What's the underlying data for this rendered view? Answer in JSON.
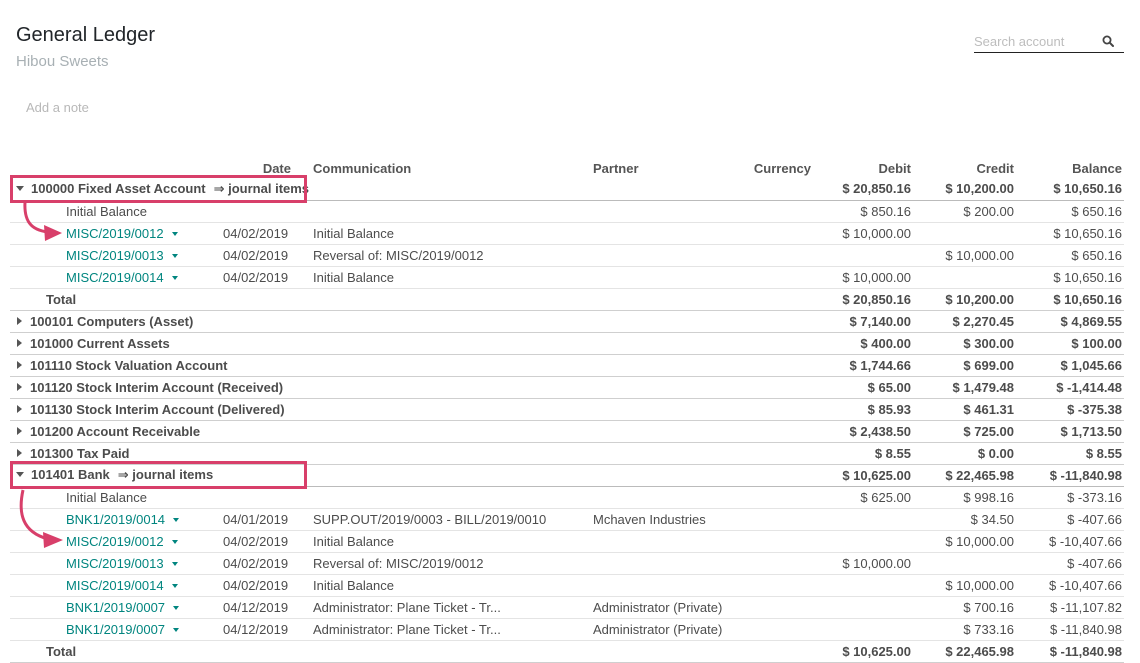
{
  "header": {
    "title": "General Ledger",
    "company": "Hibou Sweets",
    "note_placeholder": "Add a note"
  },
  "search": {
    "placeholder": "Search account",
    "icon": "search-icon"
  },
  "columns": [
    "",
    "Date",
    "Communication",
    "Partner",
    "Currency",
    "Debit",
    "Credit",
    "Balance"
  ],
  "accounts": [
    {
      "name": "100000 Fixed Asset Account",
      "expanded": true,
      "journal_link": "⇒ journal items",
      "debit": "$ 20,850.16",
      "credit": "$ 10,200.00",
      "balance": "$ 10,650.16",
      "initial": {
        "label": "Initial Balance",
        "debit": "$ 850.16",
        "credit": "$ 200.00",
        "balance": "$ 650.16"
      },
      "lines": [
        {
          "ref": "MISC/2019/0012",
          "date": "04/02/2019",
          "comm": "Initial Balance",
          "partner": "",
          "currency": "",
          "debit": "$ 10,000.00",
          "credit": "",
          "balance": "$ 10,650.16"
        },
        {
          "ref": "MISC/2019/0013",
          "date": "04/02/2019",
          "comm": "Reversal of: MISC/2019/0012",
          "partner": "",
          "currency": "",
          "debit": "",
          "credit": "$ 10,000.00",
          "balance": "$ 650.16"
        },
        {
          "ref": "MISC/2019/0014",
          "date": "04/02/2019",
          "comm": "Initial Balance",
          "partner": "",
          "currency": "",
          "debit": "$ 10,000.00",
          "credit": "",
          "balance": "$ 10,650.16"
        }
      ],
      "total": {
        "label": "Total",
        "debit": "$ 20,850.16",
        "credit": "$ 10,200.00",
        "balance": "$ 10,650.16"
      }
    },
    {
      "name": "100101 Computers (Asset)",
      "expanded": false,
      "debit": "$ 7,140.00",
      "credit": "$ 2,270.45",
      "balance": "$ 4,869.55"
    },
    {
      "name": "101000 Current Assets",
      "expanded": false,
      "debit": "$ 400.00",
      "credit": "$ 300.00",
      "balance": "$ 100.00"
    },
    {
      "name": "101110 Stock Valuation Account",
      "expanded": false,
      "debit": "$ 1,744.66",
      "credit": "$ 699.00",
      "balance": "$ 1,045.66"
    },
    {
      "name": "101120 Stock Interim Account (Received)",
      "expanded": false,
      "debit": "$ 65.00",
      "credit": "$ 1,479.48",
      "balance": "$ -1,414.48"
    },
    {
      "name": "101130 Stock Interim Account (Delivered)",
      "expanded": false,
      "debit": "$ 85.93",
      "credit": "$ 461.31",
      "balance": "$ -375.38"
    },
    {
      "name": "101200 Account Receivable",
      "expanded": false,
      "debit": "$ 2,438.50",
      "credit": "$ 725.00",
      "balance": "$ 1,713.50"
    },
    {
      "name": "101300 Tax Paid",
      "expanded": false,
      "debit": "$ 8.55",
      "credit": "$ 0.00",
      "balance": "$ 8.55"
    },
    {
      "name": "101401 Bank",
      "expanded": true,
      "journal_link": "⇒ journal items",
      "debit": "$ 10,625.00",
      "credit": "$ 22,465.98",
      "balance": "$ -11,840.98",
      "initial": {
        "label": "Initial Balance",
        "debit": "$ 625.00",
        "credit": "$ 998.16",
        "balance": "$ -373.16"
      },
      "lines": [
        {
          "ref": "BNK1/2019/0014",
          "date": "04/01/2019",
          "comm": "SUPP.OUT/2019/0003 - BILL/2019/0010",
          "partner": "Mchaven Industries",
          "currency": "",
          "debit": "",
          "credit": "$ 34.50",
          "balance": "$ -407.66"
        },
        {
          "ref": "MISC/2019/0012",
          "date": "04/02/2019",
          "comm": "Initial Balance",
          "partner": "",
          "currency": "",
          "debit": "",
          "credit": "$ 10,000.00",
          "balance": "$ -10,407.66"
        },
        {
          "ref": "MISC/2019/0013",
          "date": "04/02/2019",
          "comm": "Reversal of: MISC/2019/0012",
          "partner": "",
          "currency": "",
          "debit": "$ 10,000.00",
          "credit": "",
          "balance": "$ -407.66"
        },
        {
          "ref": "MISC/2019/0014",
          "date": "04/02/2019",
          "comm": "Initial Balance",
          "partner": "",
          "currency": "",
          "debit": "",
          "credit": "$ 10,000.00",
          "balance": "$ -10,407.66"
        },
        {
          "ref": "BNK1/2019/0007",
          "date": "04/12/2019",
          "comm": "Administrator: Plane Ticket - Tr...",
          "partner": "Administrator (Private)",
          "currency": "",
          "debit": "",
          "credit": "$ 700.16",
          "balance": "$ -11,107.82"
        },
        {
          "ref": "BNK1/2019/0007",
          "date": "04/12/2019",
          "comm": "Administrator: Plane Ticket - Tr...",
          "partner": "Administrator (Private)",
          "currency": "",
          "debit": "",
          "credit": "$ 733.16",
          "balance": "$ -11,840.98"
        }
      ],
      "total": {
        "label": "Total",
        "debit": "$ 10,625.00",
        "credit": "$ 22,465.98",
        "balance": "$ -11,840.98"
      }
    }
  ],
  "colors": {
    "link": "#00857f",
    "highlight": "#d83f6a"
  }
}
